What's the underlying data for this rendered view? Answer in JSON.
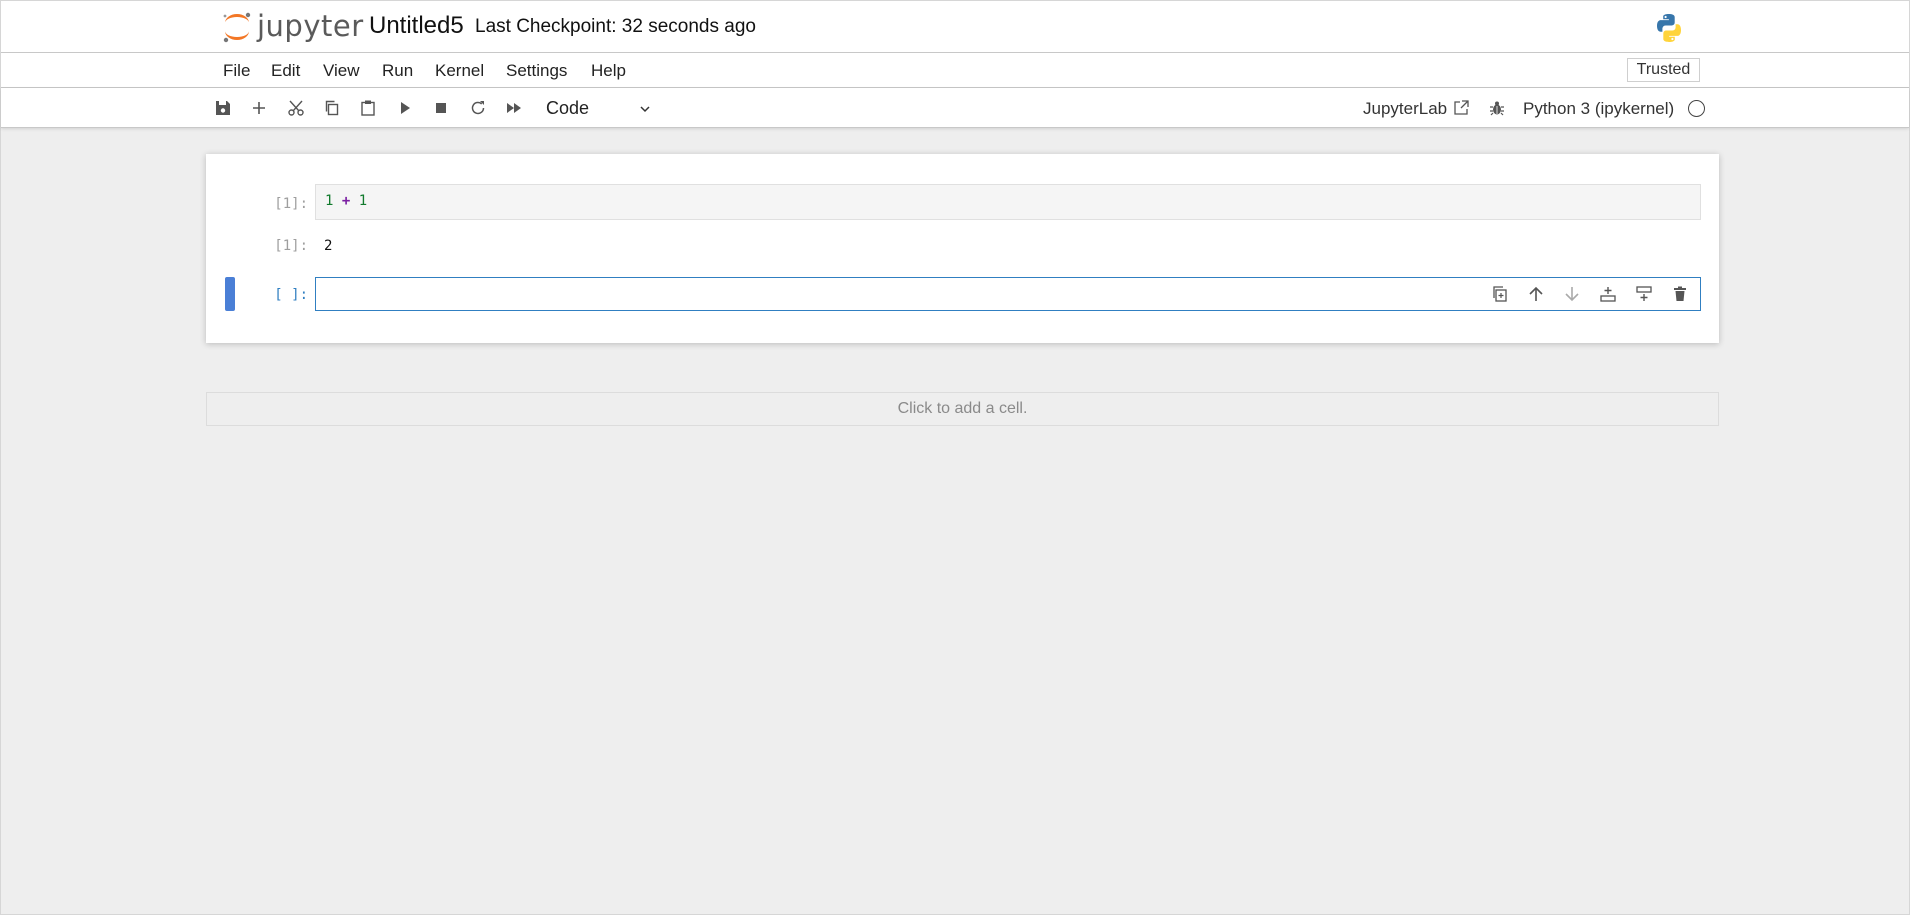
{
  "header": {
    "logo_text": "jupyter",
    "notebook_title": "Untitled5",
    "checkpoint": "Last Checkpoint: 32 seconds ago",
    "python_logo": "python-logo-icon"
  },
  "menu": {
    "items": [
      "File",
      "Edit",
      "View",
      "Run",
      "Kernel",
      "Settings",
      "Help"
    ],
    "trusted_label": "Trusted"
  },
  "toolbar": {
    "buttons": [
      "save-icon",
      "add-icon",
      "cut-icon",
      "copy-icon",
      "paste-icon",
      "run-icon",
      "stop-icon",
      "restart-icon",
      "fast-forward-icon"
    ],
    "cell_type": "Code",
    "jupyterlab_label": "JupyterLab",
    "kernel_name": "Python 3 (ipykernel)",
    "kernel_status": "idle"
  },
  "cells": [
    {
      "prompt": "[1]:",
      "code_left": "1",
      "code_op": "+",
      "code_right": "1"
    },
    {
      "output_prompt": "[1]:",
      "output": "2"
    },
    {
      "prompt": "[ ]:",
      "active": true
    }
  ],
  "cell_tools": [
    "duplicate-icon",
    "move-up-icon",
    "move-down-icon",
    "insert-above-icon",
    "insert-below-icon",
    "delete-icon"
  ],
  "add_cell_label": "Click to add a cell.",
  "colors": {
    "accent": "#307fc1",
    "active_bar": "#4a7fd6",
    "jupyter_orange": "#f37726"
  }
}
